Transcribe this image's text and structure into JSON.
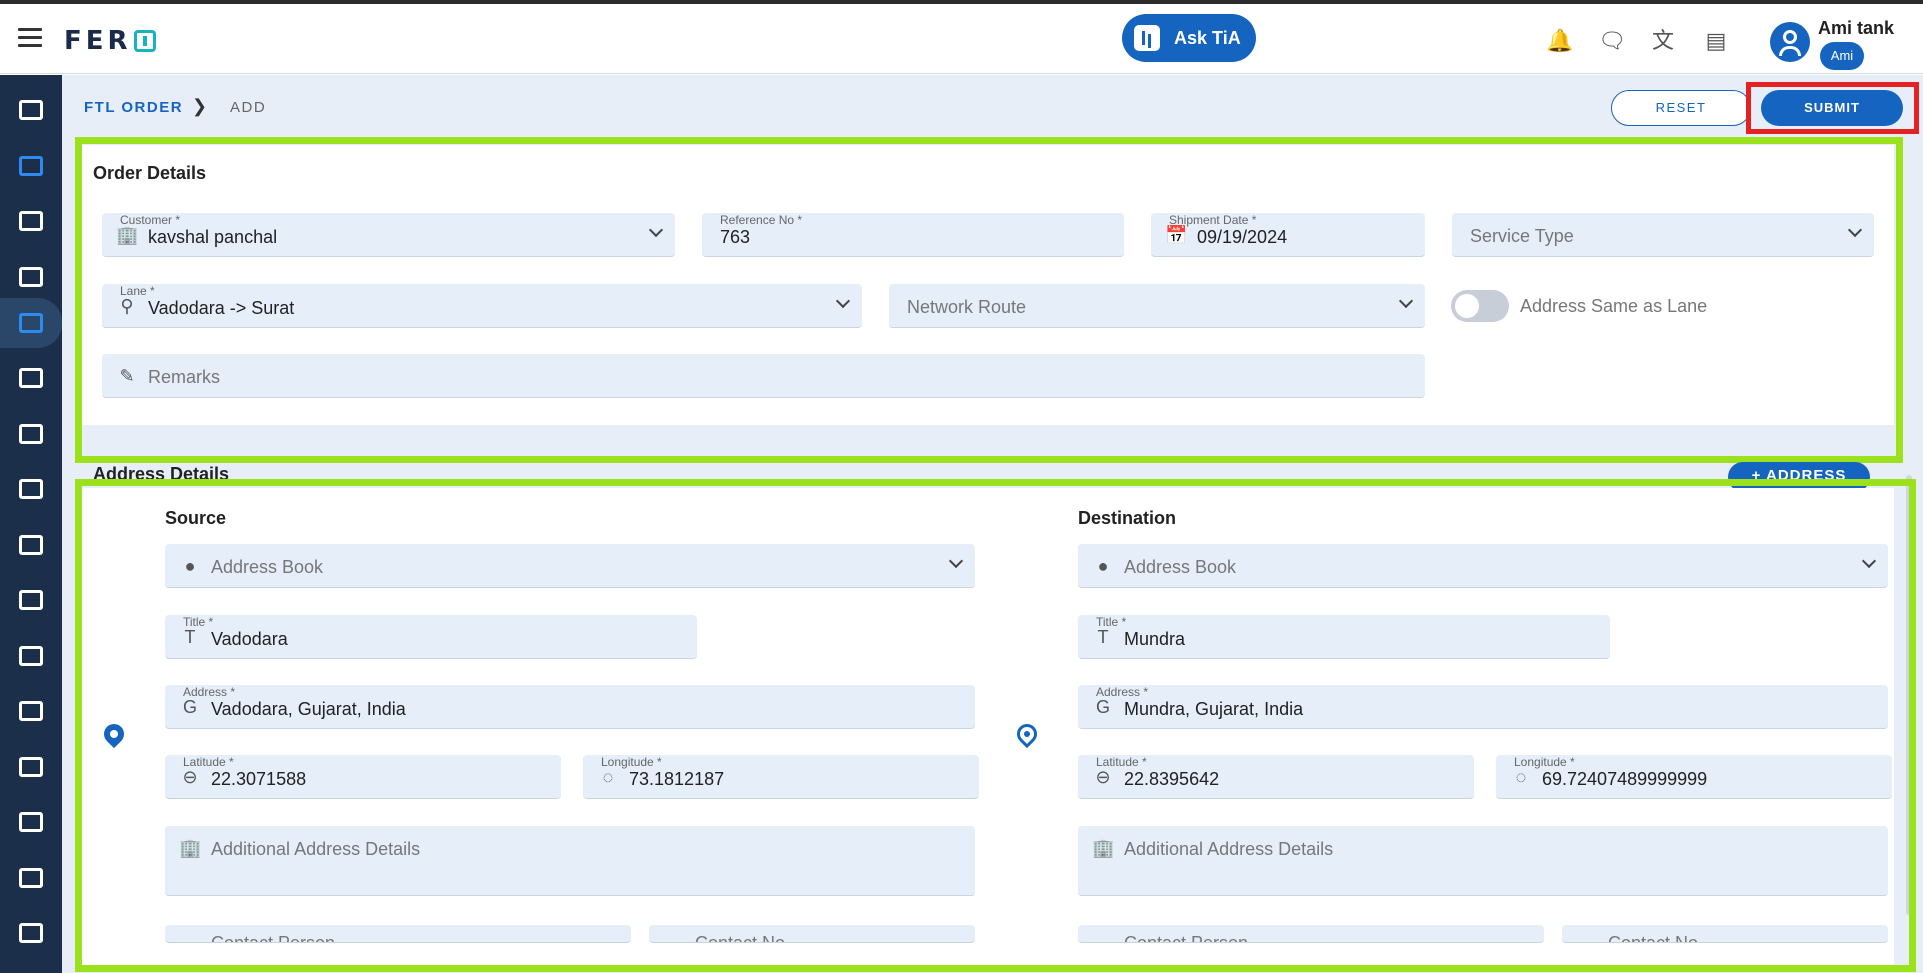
{
  "app": {
    "logo_text": "FER"
  },
  "header": {
    "ask_button": "Ask TiA",
    "icons": [
      "bell-icon",
      "chat-icon",
      "translate-icon",
      "panel-icon"
    ],
    "user_name": "Ami tank",
    "user_badge": "Ami"
  },
  "sidebar": {
    "items": [
      "dashboard",
      "order-box",
      "warehouse",
      "scale",
      "truck-active",
      "truck",
      "document",
      "database",
      "bus-settings",
      "settings",
      "money",
      "delivery-truck",
      "excel",
      "building",
      "route",
      "list"
    ]
  },
  "breadcrumb": {
    "root": "FTL ORDER",
    "current": "ADD"
  },
  "actions": {
    "reset": "RESET",
    "submit": "SUBMIT"
  },
  "order_details": {
    "title": "Order Details",
    "customer": {
      "label": "Customer *",
      "value": "kavshal panchal"
    },
    "reference": {
      "label": "Reference No *",
      "value": "763"
    },
    "shipment_date": {
      "label": "Shipment Date *",
      "value": "09/19/2024"
    },
    "service_type": {
      "placeholder": "Service Type"
    },
    "lane": {
      "label": "Lane *",
      "value": "Vadodara -> Surat"
    },
    "network_route": {
      "placeholder": "Network Route"
    },
    "address_same": {
      "label": "Address Same as Lane",
      "on": false
    },
    "remarks": {
      "placeholder": "Remarks"
    }
  },
  "address_details": {
    "title": "Address Details",
    "add_button": "+ ADDRESS",
    "source": {
      "title": "Source",
      "address_book": "Address Book",
      "title_field": {
        "label": "Title *",
        "value": "Vadodara"
      },
      "address": {
        "label": "Address *",
        "value": "Vadodara, Gujarat, India"
      },
      "latitude": {
        "label": "Latitude *",
        "value": "22.3071588"
      },
      "longitude": {
        "label": "Longitude *",
        "value": "73.1812187"
      },
      "additional": "Additional Address Details",
      "contact_person": "Contact Person",
      "contact_no": "Contact No"
    },
    "destination": {
      "title": "Destination",
      "address_book": "Address Book",
      "title_field": {
        "label": "Title *",
        "value": "Mundra"
      },
      "address": {
        "label": "Address *",
        "value": "Mundra, Gujarat, India"
      },
      "latitude": {
        "label": "Latitude *",
        "value": "22.8395642"
      },
      "longitude": {
        "label": "Longitude *",
        "value": "69.72407489999999"
      },
      "additional": "Additional Address Details",
      "contact_person": "Contact Person",
      "contact_no": "Contact No"
    }
  },
  "colors": {
    "primary": "#1565c0",
    "highlight_green": "#9be21d",
    "highlight_red": "#e52222",
    "sidebar": "#1b2f4b"
  }
}
